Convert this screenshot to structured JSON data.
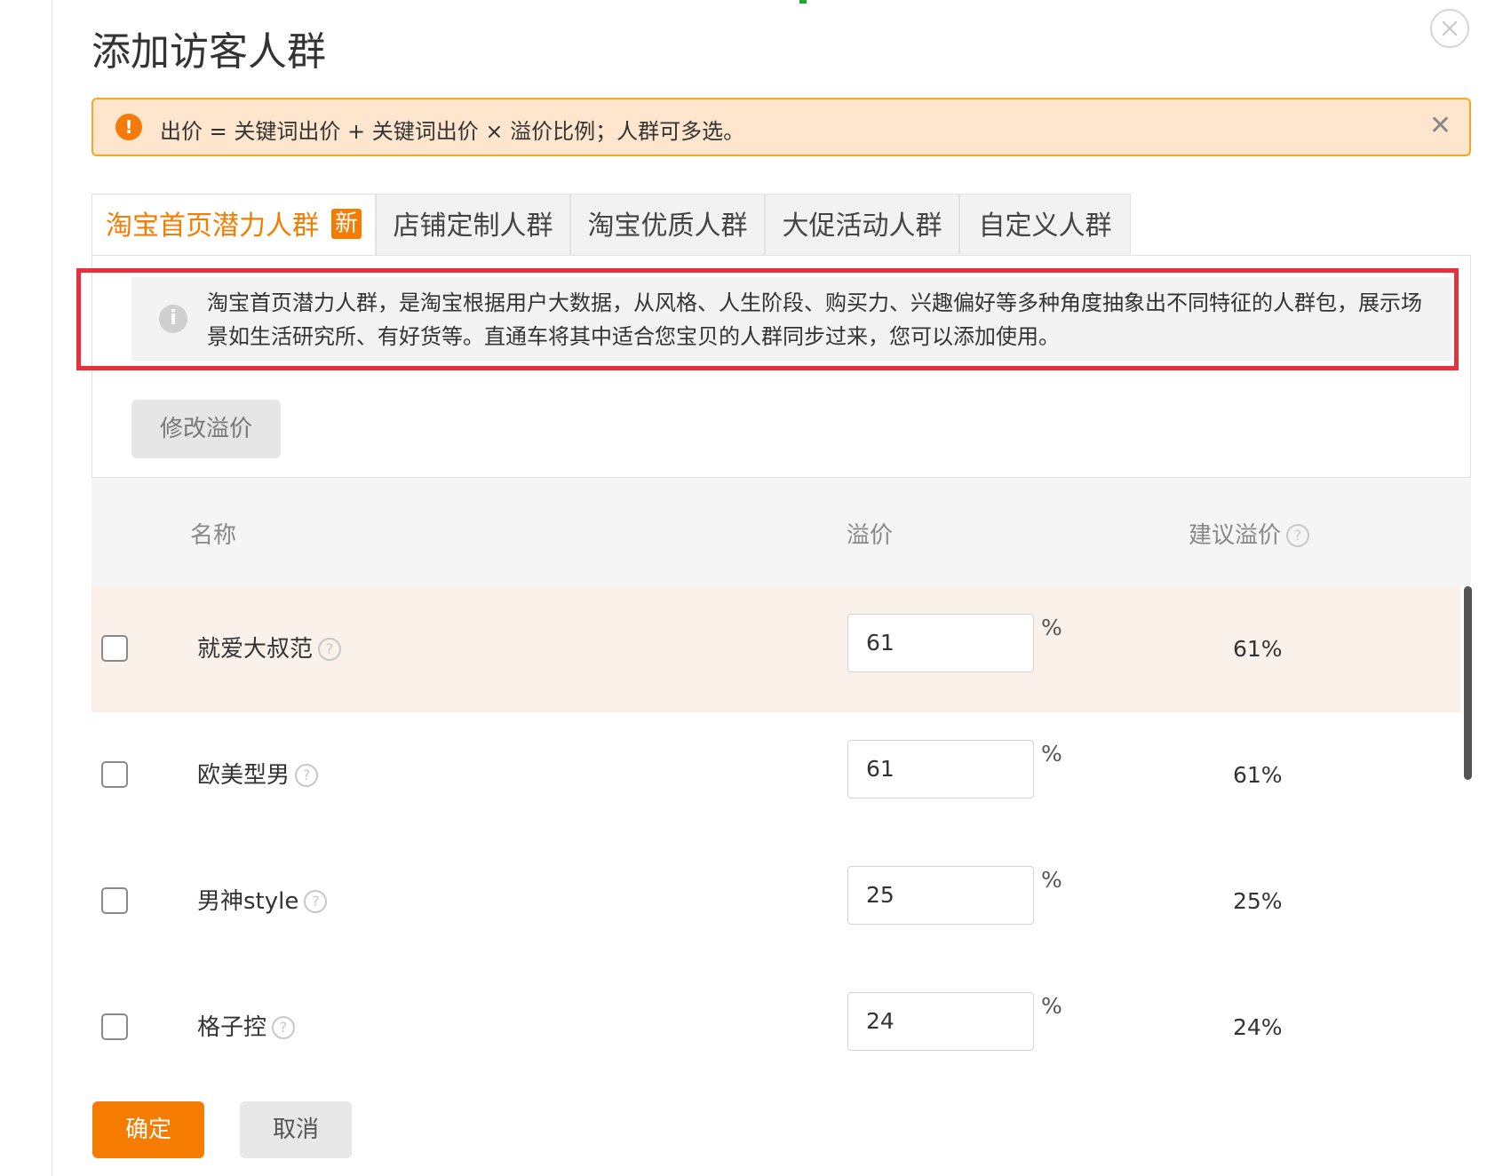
{
  "dialog": {
    "title": "添加访客人群"
  },
  "alert": {
    "icon": "!",
    "text": "出价 = 关键词出价 + 关键词出价 × 溢价比例；人群可多选。",
    "close": "✕"
  },
  "tabs": [
    {
      "label": "淘宝首页潜力人群",
      "badge": "新",
      "active": true
    },
    {
      "label": "店铺定制人群",
      "active": false
    },
    {
      "label": "淘宝优质人群",
      "active": false
    },
    {
      "label": "大促活动人群",
      "active": false
    },
    {
      "label": "自定义人群",
      "active": false
    }
  ],
  "info": {
    "icon": "i",
    "text": "淘宝首页潜力人群，是淘宝根据用户大数据，从风格、人生阶段、购买力、兴趣偏好等多种角度抽象出不同特征的人群包，展示场景如生活研究所、有好货等。直通车将其中适合您宝贝的人群同步过来，您可以添加使用。"
  },
  "toolbar": {
    "modify_label": "修改溢价"
  },
  "table": {
    "headers": {
      "name": "名称",
      "premium": "溢价",
      "suggested": "建议溢价"
    },
    "help_glyph": "?",
    "rows": [
      {
        "name": "就爱大叔范",
        "premium": "61",
        "unit": "%",
        "suggested": "61%"
      },
      {
        "name": "欧美型男",
        "premium": "61",
        "unit": "%",
        "suggested": "61%"
      },
      {
        "name": "男神style",
        "premium": "25",
        "unit": "%",
        "suggested": "25%"
      },
      {
        "name": "格子控",
        "premium": "24",
        "unit": "%",
        "suggested": "24%"
      }
    ]
  },
  "footer": {
    "confirm_label": "确定",
    "cancel_label": "取消"
  },
  "colors": {
    "accent": "#f57c00",
    "alert_bg": "#fee5cd",
    "alert_border": "#f5a623",
    "highlight_border": "#e8303a"
  }
}
